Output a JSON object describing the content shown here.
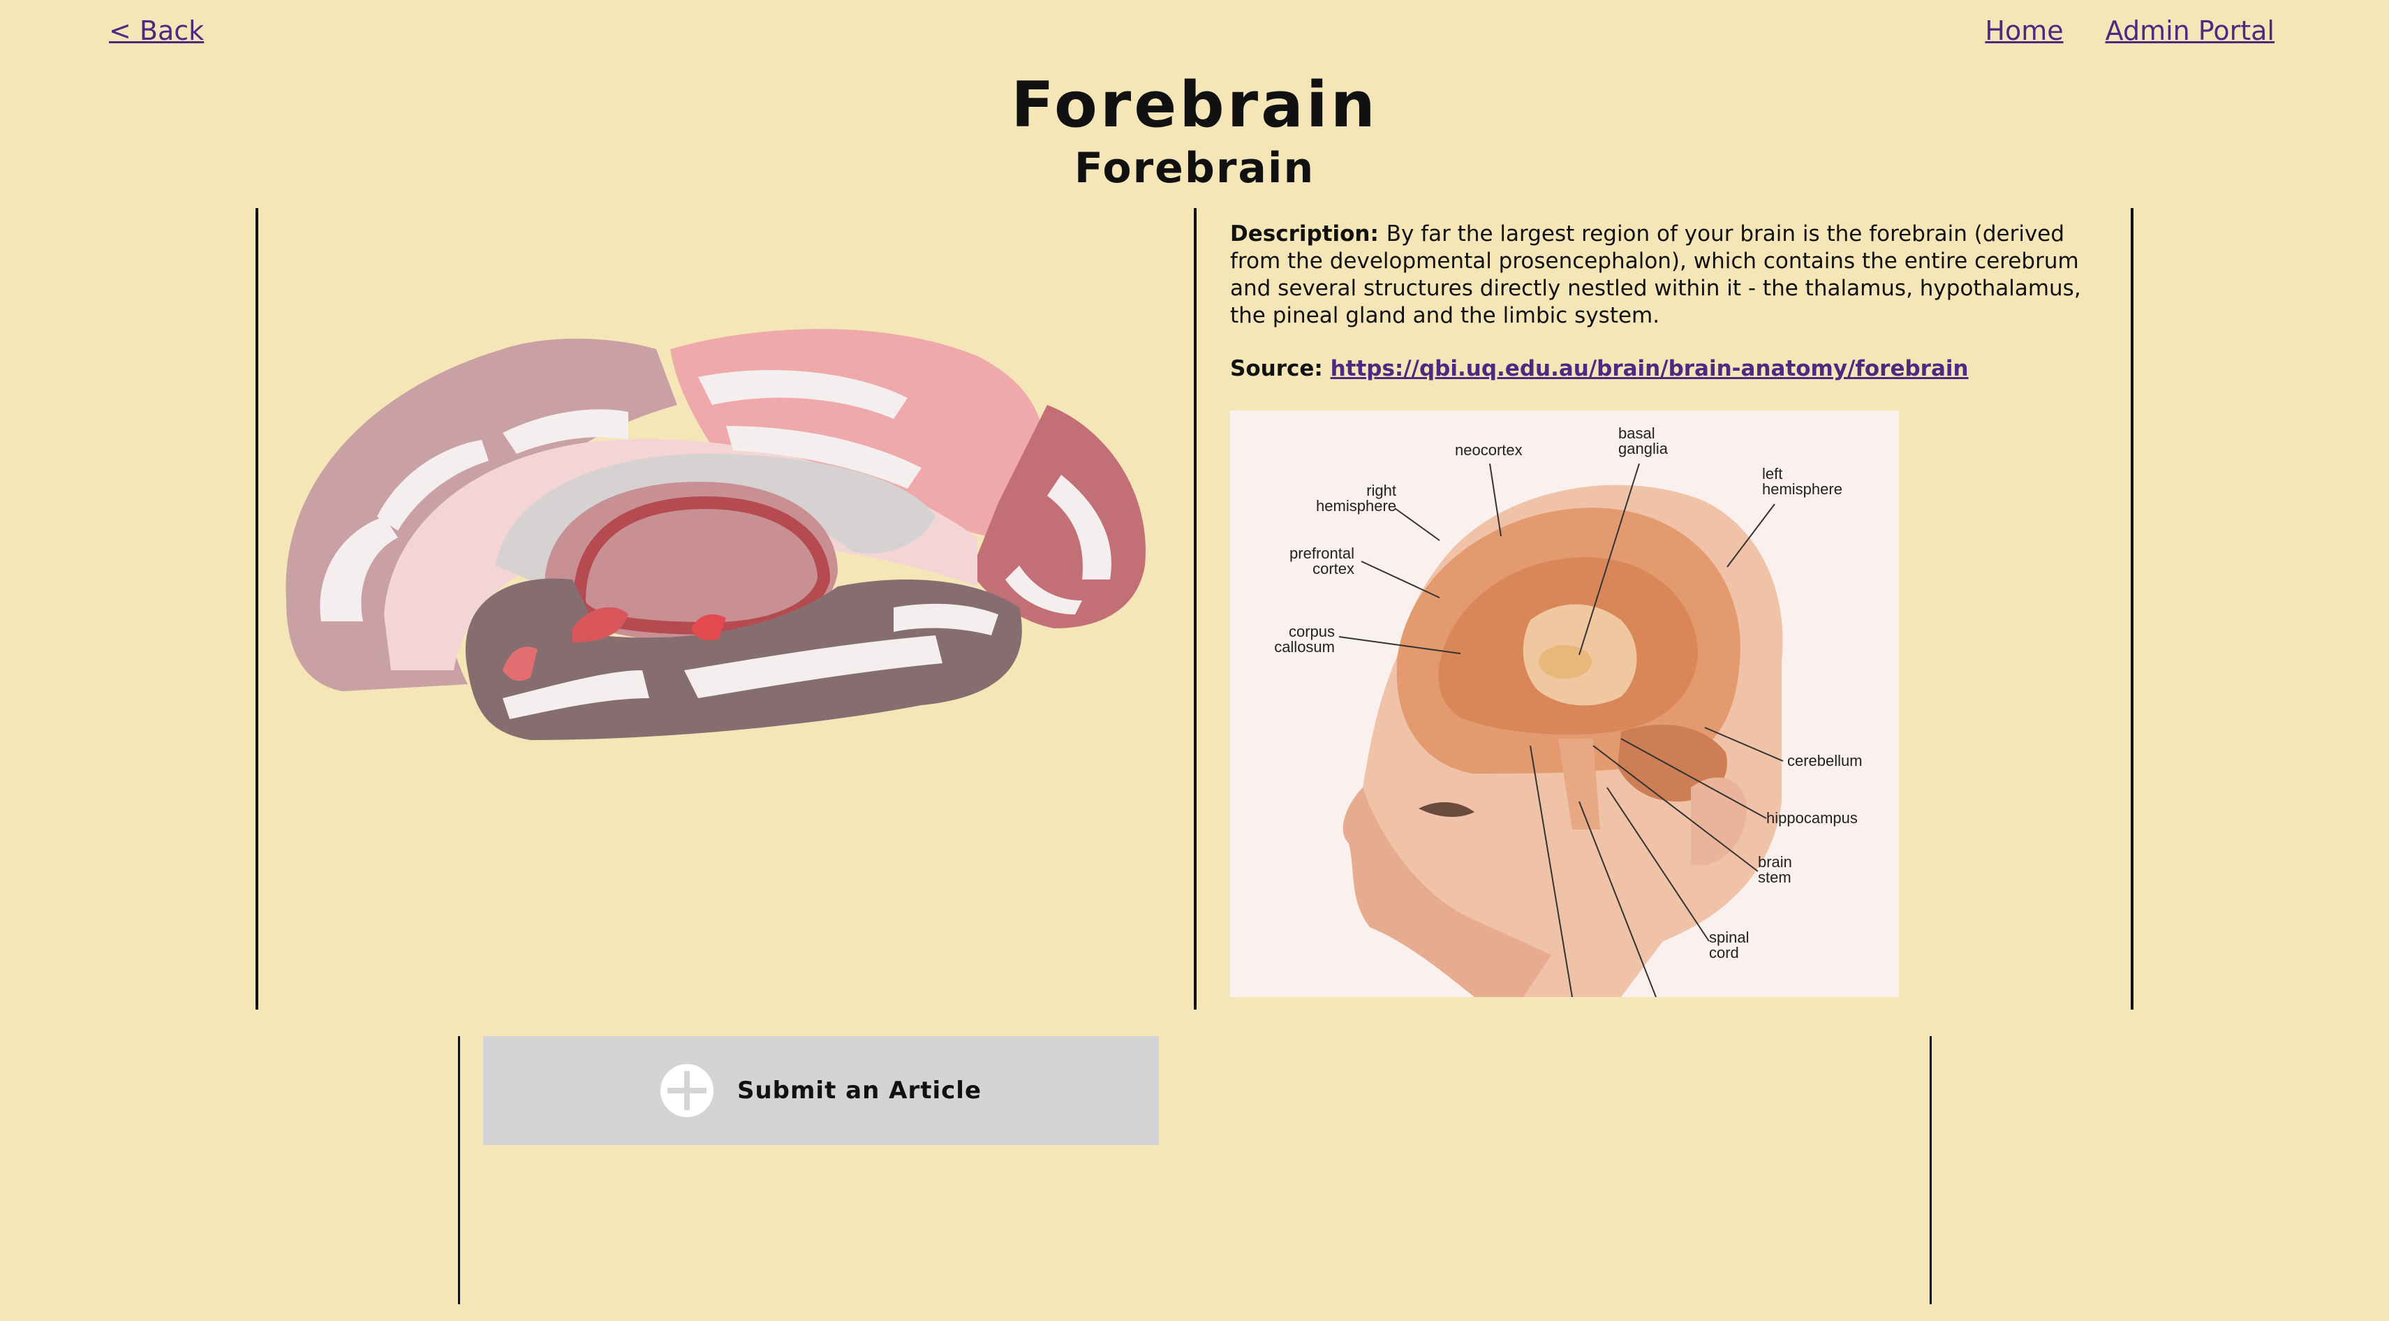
{
  "nav": {
    "back_label": "< Back",
    "home_label": "Home",
    "admin_label": "Admin Portal"
  },
  "page": {
    "title": "Forebrain",
    "subtitle": "Forebrain"
  },
  "article": {
    "description_label": "Description:",
    "description_text": "By far the largest region of your brain is the forebrain (derived from the developmental prosencephalon), which contains the entire cerebrum and several structures directly nestled within it - the thalamus, hypothalamus, the pineal gland and the limbic system.",
    "source_label": "Source:",
    "source_url": "https://qbi.uq.edu.au/brain/brain-anatomy/forebrain"
  },
  "illustration": {
    "labels": {
      "neocortex": "neocortex",
      "basal_ganglia_1": "basal",
      "basal_ganglia_2": "ganglia",
      "left_hem_1": "left",
      "left_hem_2": "hemisphere",
      "right_hem_1": "right",
      "right_hem_2": "hemisphere",
      "prefrontal_1": "prefrontal",
      "prefrontal_2": "cortex",
      "corpus_1": "corpus",
      "corpus_2": "callosum",
      "cerebellum": "cerebellum",
      "hippocampus": "hippocampus",
      "brainstem_1": "brain",
      "brainstem_2": "stem",
      "spinal_1": "spinal",
      "spinal_2": "cord"
    }
  },
  "submit": {
    "label": "Submit an Article",
    "icon": "plus-circle-icon"
  },
  "colors": {
    "background": "#f5e6b8",
    "link": "#4b2a82",
    "button": "#d4d4d4"
  }
}
